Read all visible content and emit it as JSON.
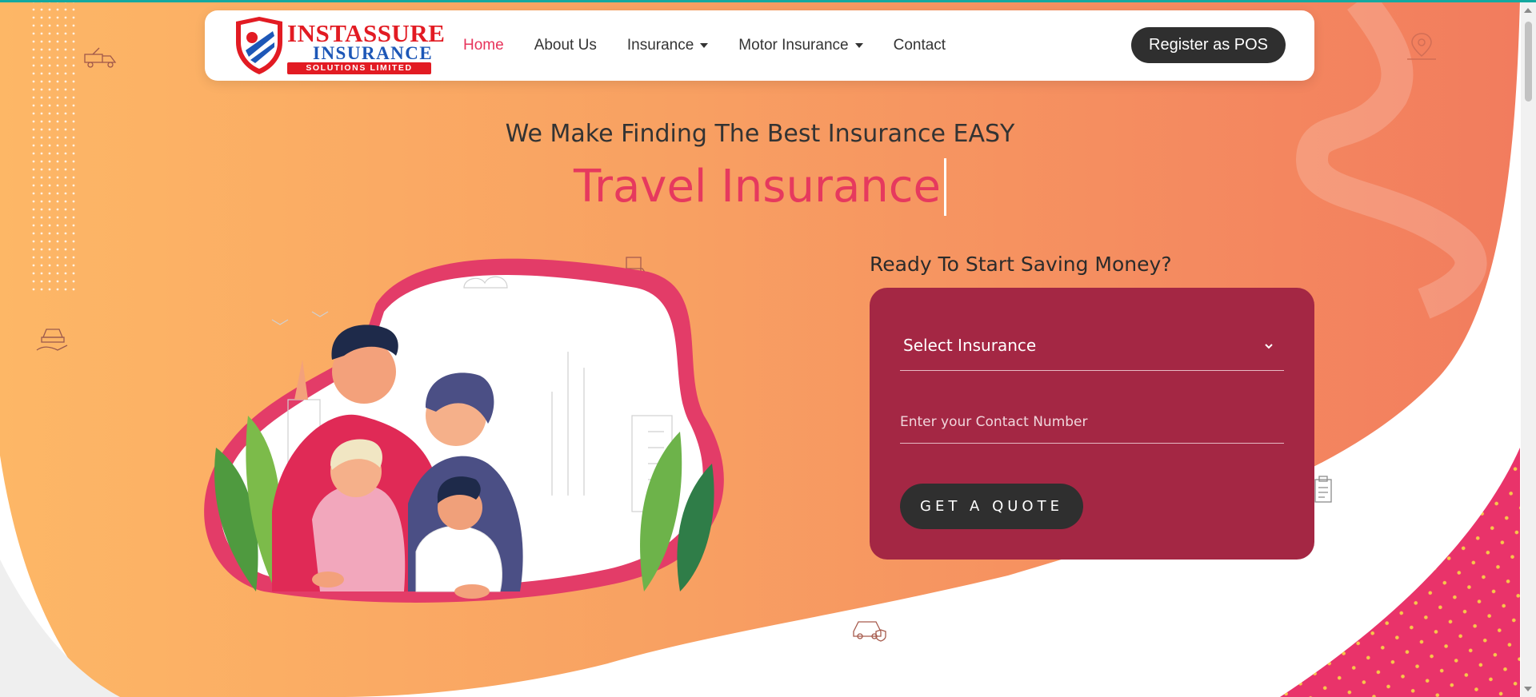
{
  "brand": {
    "name_line1": "INSTASSURE",
    "name_line2": "INSURANCE",
    "name_line3": "SOLUTIONS LIMITED"
  },
  "nav": {
    "items": [
      {
        "label": "Home",
        "active": true,
        "dropdown": false
      },
      {
        "label": "About Us",
        "active": false,
        "dropdown": false
      },
      {
        "label": "Insurance",
        "active": false,
        "dropdown": true
      },
      {
        "label": "Motor Insurance",
        "active": false,
        "dropdown": true
      },
      {
        "label": "Contact",
        "active": false,
        "dropdown": false
      }
    ],
    "cta_label": "Register as POS"
  },
  "hero": {
    "subtitle": "We Make Finding The Best Insurance EASY",
    "title": "Travel Insurance"
  },
  "form": {
    "heading": "Ready To Start Saving Money?",
    "select_value": "Select Insurance",
    "contact_placeholder": "Enter your Contact Number",
    "submit_label": "GET A QUOTE"
  },
  "colors": {
    "accent": "#e7345b",
    "form_bg": "#a42744",
    "button_dark": "#2f2f2f",
    "gradient_left": "#fbb465",
    "gradient_right": "#f3805f",
    "top_strip": "#14a9a0"
  },
  "icons": [
    "shield-logo-icon",
    "chevron-down-icon",
    "map-pin-icon",
    "tow-truck-icon",
    "car-hand-icon",
    "car-money-icon",
    "car-shield-icon",
    "clipboard-icon"
  ]
}
